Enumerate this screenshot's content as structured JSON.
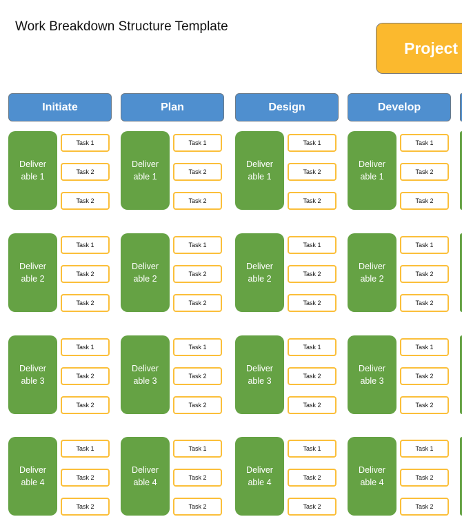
{
  "title": "Work Breakdown Structure Template",
  "project_label": "Project",
  "colors": {
    "phase": "#4f8fcf",
    "deliverable": "#65a244",
    "task_border": "#fbbf3a",
    "project": "#fbb92e"
  },
  "phases": [
    {
      "label": "Initiate",
      "deliverables": [
        {
          "label": "Deliver able 1",
          "tasks": [
            "Task 1",
            "Task 2",
            "Task 2"
          ]
        },
        {
          "label": "Deliver able 2",
          "tasks": [
            "Task 1",
            "Task 2",
            "Task 2"
          ]
        },
        {
          "label": "Deliver able 3",
          "tasks": [
            "Task 1",
            "Task 2",
            "Task 2"
          ]
        },
        {
          "label": "Deliver able 4",
          "tasks": [
            "Task 1",
            "Task 2",
            "Task 2"
          ]
        }
      ]
    },
    {
      "label": "Plan",
      "deliverables": [
        {
          "label": "Deliver able 1",
          "tasks": [
            "Task 1",
            "Task 2",
            "Task 2"
          ]
        },
        {
          "label": "Deliver able 2",
          "tasks": [
            "Task 1",
            "Task 2",
            "Task 2"
          ]
        },
        {
          "label": "Deliver able 3",
          "tasks": [
            "Task 1",
            "Task 2",
            "Task 2"
          ]
        },
        {
          "label": "Deliver able 4",
          "tasks": [
            "Task 1",
            "Task 2",
            "Task 2"
          ]
        }
      ]
    },
    {
      "label": "Design",
      "deliverables": [
        {
          "label": "Deliver able 1",
          "tasks": [
            "Task 1",
            "Task 2",
            "Task 2"
          ]
        },
        {
          "label": "Deliver able 2",
          "tasks": [
            "Task 1",
            "Task 2",
            "Task 2"
          ]
        },
        {
          "label": "Deliver able 3",
          "tasks": [
            "Task 1",
            "Task 2",
            "Task 2"
          ]
        },
        {
          "label": "Deliver able 4",
          "tasks": [
            "Task 1",
            "Task 2",
            "Task 2"
          ]
        }
      ]
    },
    {
      "label": "Develop",
      "deliverables": [
        {
          "label": "Deliver able 1",
          "tasks": [
            "Task 1",
            "Task 2",
            "Task 2"
          ]
        },
        {
          "label": "Deliver able 2",
          "tasks": [
            "Task 1",
            "Task 2",
            "Task 2"
          ]
        },
        {
          "label": "Deliver able 3",
          "tasks": [
            "Task 1",
            "Task 2",
            "Task 2"
          ]
        },
        {
          "label": "Deliver able 4",
          "tasks": [
            "Task 1",
            "Task 2",
            "Task 2"
          ]
        }
      ]
    }
  ]
}
